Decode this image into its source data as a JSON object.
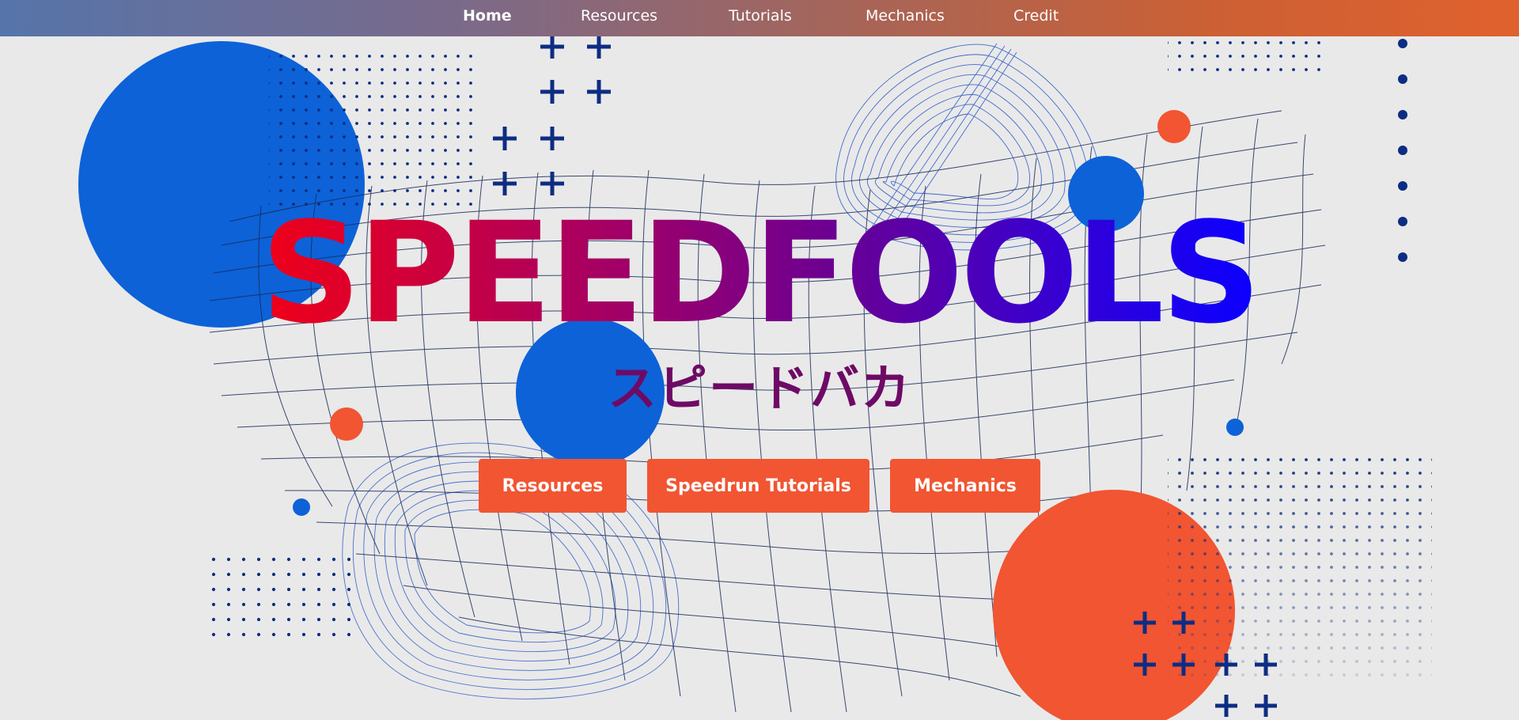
{
  "nav": {
    "items": [
      {
        "label": "Home",
        "active": true
      },
      {
        "label": "Resources",
        "active": false
      },
      {
        "label": "Tutorials",
        "active": false
      },
      {
        "label": "Mechanics",
        "active": false
      },
      {
        "label": "Credit",
        "active": false
      }
    ]
  },
  "hero": {
    "title": "SPEEDFOOLS",
    "subtitle": "スピードバカ"
  },
  "buttons": {
    "resources": "Resources",
    "tutorials": "Speedrun Tutorials",
    "mechanics": "Mechanics"
  },
  "colors": {
    "nav_gradient_start": "#5674aa",
    "nav_gradient_end": "#e0612e",
    "background": "#e9e9e9",
    "accent_orange": "#f15532",
    "accent_blue": "#0d62d8",
    "dark_navy": "#0d2d82",
    "subtitle_purple": "#6e0a66"
  }
}
